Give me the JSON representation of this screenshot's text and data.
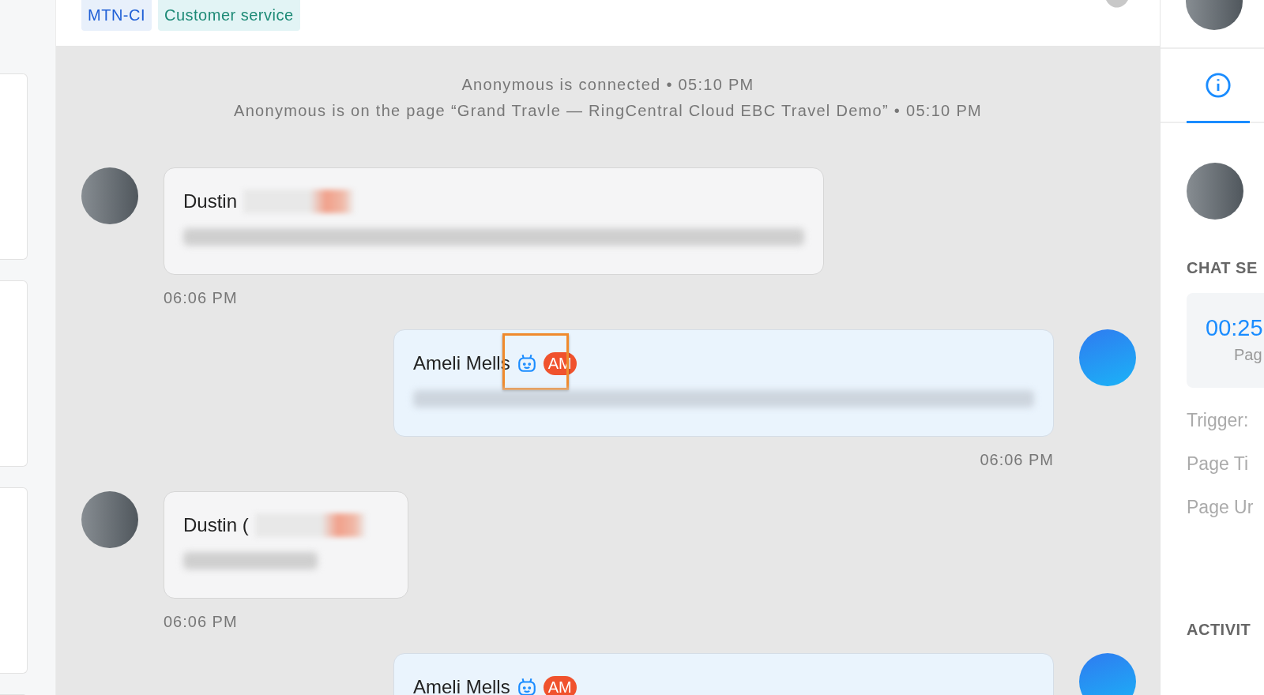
{
  "header": {
    "tags": [
      {
        "label": "MTN-CI",
        "kind": "queue"
      },
      {
        "label": "Customer service",
        "kind": "topic"
      }
    ]
  },
  "system_messages": [
    "Anonymous is connected • 05:10 PM",
    "Anonymous is on the page “Grand Travle — RingCentral Cloud EBC Travel Demo” • 05:10 PM"
  ],
  "messages": [
    {
      "kind": "visitor",
      "name": "Dustin",
      "time": "06:06 PM",
      "bot": false,
      "highlighted": false
    },
    {
      "kind": "agent",
      "name": "Ameli Mells",
      "badge": "AM",
      "time": "06:06 PM",
      "bot": true,
      "highlighted": true
    },
    {
      "kind": "visitor",
      "name": "Dustin (",
      "time": "06:06 PM",
      "bot": false,
      "highlighted": false
    },
    {
      "kind": "agent",
      "name": "Ameli Mells",
      "badge": "AM",
      "bot": true,
      "highlighted": false
    }
  ],
  "side_panel": {
    "tabs": [
      {
        "kind": "info",
        "selected": true
      }
    ],
    "section_title": "CHAT SE",
    "timer": {
      "value": "00:25",
      "label": "Pag"
    },
    "fields": [
      "Trigger:",
      "Page Ti",
      "Page Ur"
    ],
    "activity_title": "ACTIVIT"
  }
}
